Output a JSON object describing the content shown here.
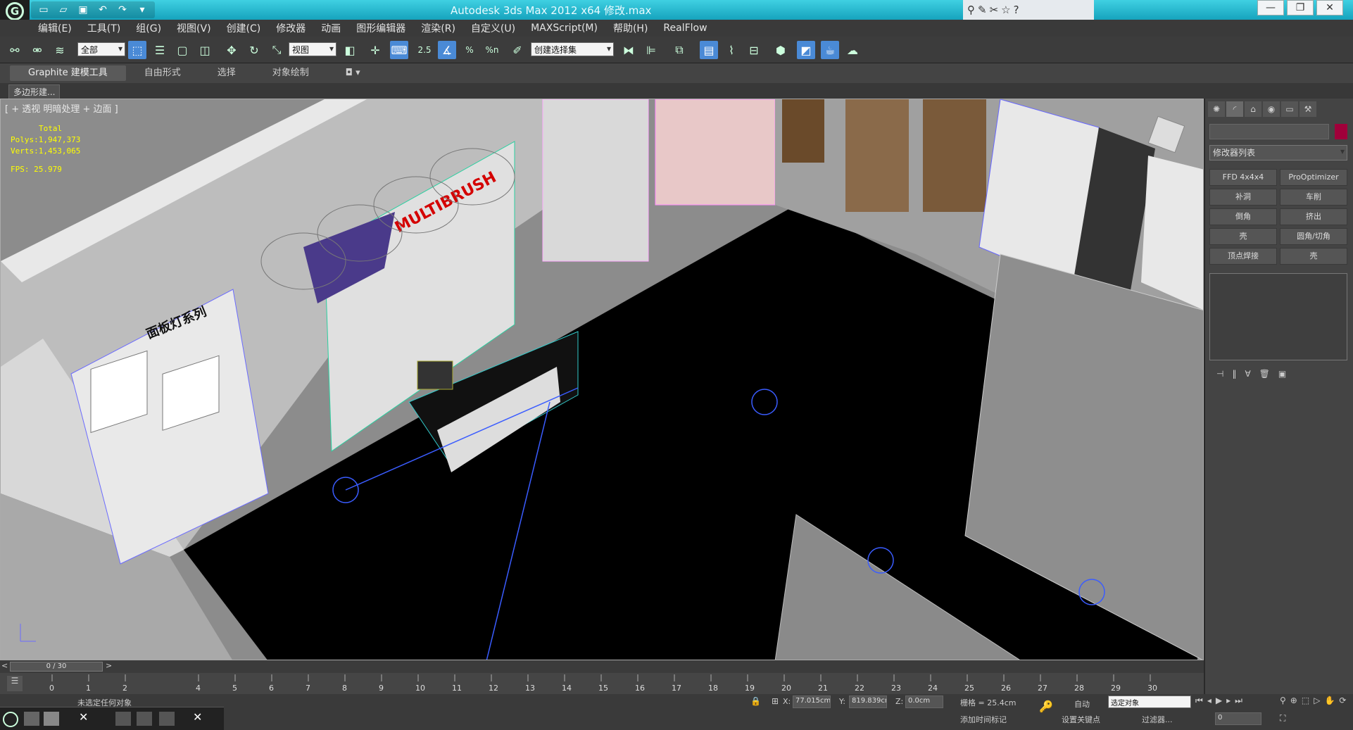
{
  "window": {
    "title": "Autodesk 3ds Max  2012 x64    修改.max",
    "logo_text": "G",
    "controls": [
      "—",
      "❐",
      "✕"
    ]
  },
  "quick_access": {
    "icons": [
      "new-icon",
      "open-icon",
      "save-icon",
      "undo-icon",
      "redo-icon",
      "dropdown-icon"
    ]
  },
  "infocenter": {
    "icons": [
      "binoculars-icon",
      "tools-icon",
      "pin-icon",
      "star-icon",
      "help-icon"
    ]
  },
  "menu": [
    "编辑(E)",
    "工具(T)",
    "组(G)",
    "视图(V)",
    "创建(C)",
    "修改器",
    "动画",
    "图形编辑器",
    "渲染(R)",
    "自定义(U)",
    "MAXScript(M)",
    "帮助(H)",
    "RealFlow"
  ],
  "toolbar": {
    "selection_filter": "全部",
    "ref_coord": "视图",
    "named_selection": "创建选择集",
    "snap_labels": [
      "2.5",
      "%",
      "%n"
    ]
  },
  "ribbon": {
    "tabs": [
      "Graphite 建模工具",
      "自由形式",
      "选择",
      "对象绘制"
    ],
    "active_tab": 0,
    "extra": "◘ ▾"
  },
  "polybar": {
    "label": "多边形建..."
  },
  "viewport": {
    "label": "[ + ] 透视 [ ] 明暗处理 + 边面 ]",
    "label_text": "[ +  透视  明暗处理 + 边面 ]",
    "stats": {
      "total": "Total",
      "polys": "Polys:1,947,373",
      "verts": "Verts:1,453,065",
      "fps": "FPS:  25.979"
    },
    "brand": "MULTIBRUSH",
    "sign": "面板灯系列",
    "axis": [
      "x",
      "y",
      "z"
    ]
  },
  "command_panel": {
    "tabs": [
      "sun-icon",
      "curve-icon",
      "hierarchy-icon",
      "motion-icon",
      "display-icon",
      "utilities-icon"
    ],
    "name_field": "",
    "modifier_list": "修改器列表",
    "buttons": [
      "FFD 4x4x4",
      "ProOptimizer",
      "补洞",
      "车削",
      "倒角",
      "挤出",
      "壳",
      "圆角/切角",
      "顶点焊接",
      "壳"
    ],
    "stack_icons": [
      "pin-stack-icon",
      "show-end-icon",
      "make-unique-icon",
      "remove-modifier-icon",
      "configure-icon"
    ]
  },
  "timeslider": {
    "label": "0 / 30",
    "prev": "<",
    "next": ">"
  },
  "trackbar": {
    "ticks": [
      "0",
      "1",
      "2",
      "4",
      "5",
      "6",
      "7",
      "8",
      "9",
      "10",
      "11",
      "12",
      "13",
      "14",
      "15",
      "16",
      "17",
      "18",
      "19",
      "20",
      "21",
      "22",
      "23",
      "24",
      "25",
      "26",
      "27",
      "28",
      "29",
      "30"
    ]
  },
  "statusbar": {
    "status": "未选定任何对象",
    "x_label": "X:",
    "x_value": "77.015cm",
    "y_label": "Y:",
    "y_value": "819.839cm",
    "z_label": "Z:",
    "z_value": "0.0cm",
    "grid": "栅格 = 25.4cm",
    "add_time_tag": "添加时间标记",
    "auto": "自动",
    "selected": "选定对象",
    "set_key": "设置关键点",
    "filter": "过滤器...",
    "frame": "0"
  }
}
